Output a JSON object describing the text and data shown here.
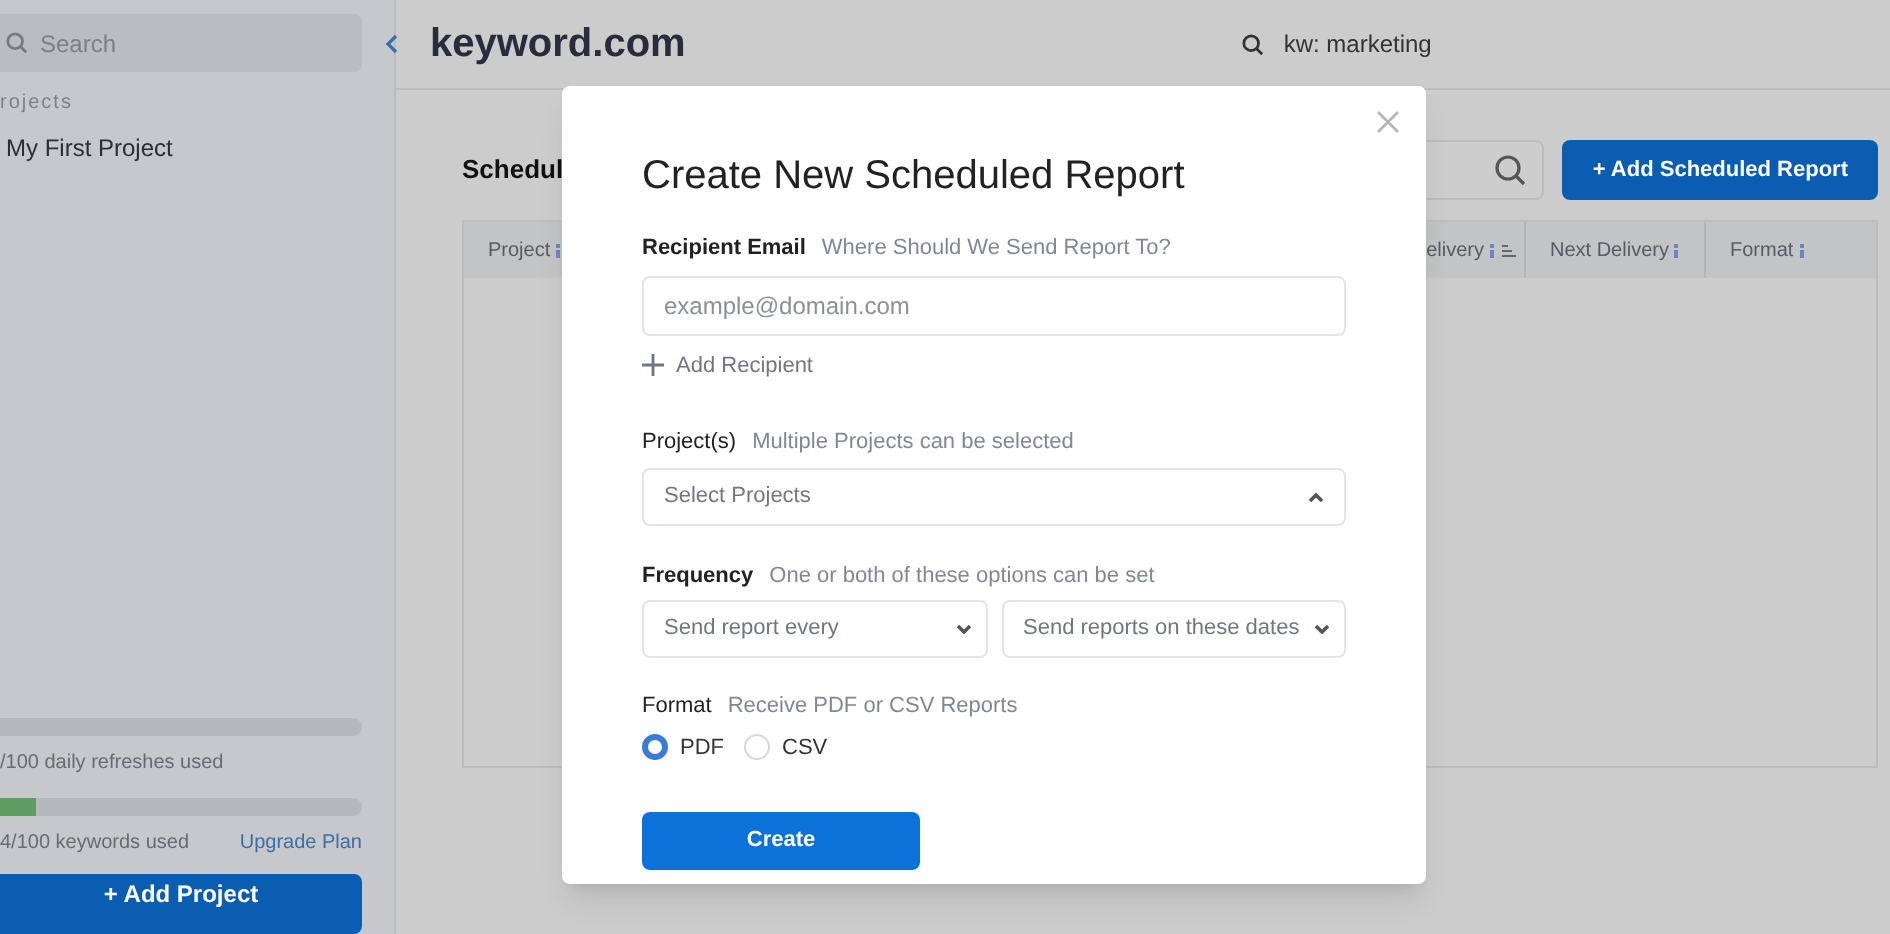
{
  "sidebar": {
    "search": {
      "placeholder": "Search"
    },
    "section_title": "rojects",
    "projects": [
      {
        "name": "My First Project"
      }
    ],
    "usage": [
      {
        "text": "/100 daily refreshes used",
        "level": 0
      },
      {
        "text": "4/100 keywords used",
        "level": 0.1,
        "link": "Upgrade Plan"
      }
    ],
    "add_button": "+ Add Project"
  },
  "header": {
    "logo": "keyword.com",
    "search_value": "kw: marketing"
  },
  "page": {
    "title": "Schedul",
    "add_button": "+ Add Scheduled Report",
    "columns": [
      {
        "label": "Project",
        "info": true,
        "sortable": false
      },
      {
        "label": "elivery",
        "info": true,
        "sortable": true
      },
      {
        "label": "Next Delivery",
        "info": true,
        "sortable": false
      },
      {
        "label": "Format",
        "info": true,
        "sortable": false
      }
    ]
  },
  "modal": {
    "title": "Create New Scheduled Report",
    "recipient": {
      "label": "Recipient Email",
      "hint": "Where Should We Send Report To?",
      "placeholder": "example@domain.com",
      "add": "Add Recipient"
    },
    "projects": {
      "label": "Project(s)",
      "hint": "Multiple Projects can be selected",
      "placeholder": "Select Projects",
      "expanded": true
    },
    "frequency": {
      "label": "Frequency",
      "hint": "One or both of these options can be set",
      "selects": [
        {
          "placeholder": "Send report every",
          "expanded": false
        },
        {
          "placeholder": "Send reports on these dates",
          "expanded": false
        }
      ]
    },
    "format": {
      "label": "Format",
      "hint": "Receive PDF or CSV Reports",
      "options": [
        {
          "label": "PDF",
          "selected": true
        },
        {
          "label": "CSV",
          "selected": false
        }
      ]
    },
    "submit": "Create"
  }
}
